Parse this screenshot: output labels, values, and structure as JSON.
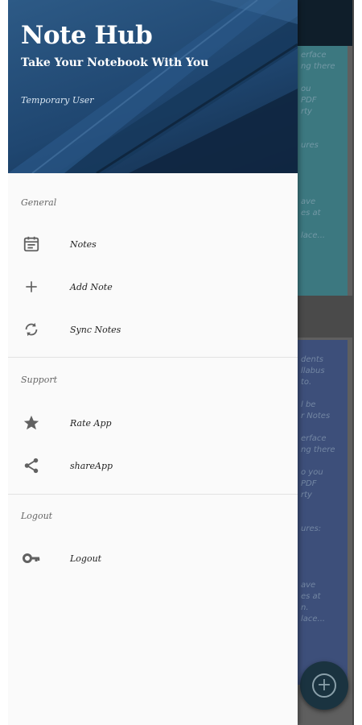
{
  "header": {
    "app_title": "Note Hub",
    "tagline": "Take Your Notebook With You",
    "user": "Temporary User"
  },
  "sections": {
    "general": "General",
    "support": "Support",
    "logout": "Logout"
  },
  "items": {
    "notes": {
      "label": "Notes",
      "icon": "calendar-note-icon"
    },
    "add_note": {
      "label": "Add Note",
      "icon": "plus-icon"
    },
    "sync_notes": {
      "label": "Sync Notes",
      "icon": "sync-icon"
    },
    "rate_app": {
      "label": "Rate App",
      "icon": "star-icon"
    },
    "share_app": {
      "label": "shareApp",
      "icon": "share-icon"
    },
    "logout": {
      "label": "Logout",
      "icon": "key-icon"
    }
  },
  "background": {
    "card1_text": "erface\nng there\n\nou\nPDF\nrty\n\n\nures\n\n\n\n\nave\nes at\n\nlace...",
    "card2_text": "dents\nllabus\nto.\n\nl be\nr Notes\n\nerface\nng there\n\no you\nPDF\nrty\n\n\nures:\n\n\n\n\nave\nes at\nn.\nlace..."
  },
  "colors": {
    "header_blue": "#1f4670",
    "drawer_bg": "#fafafa",
    "icon_gray": "#616161"
  }
}
